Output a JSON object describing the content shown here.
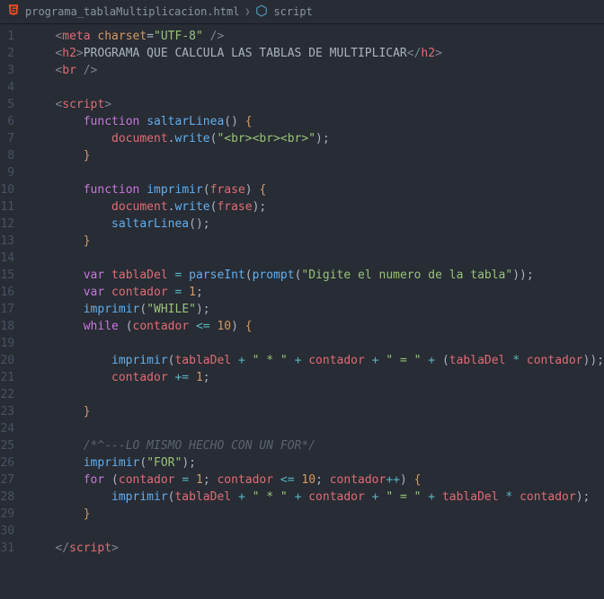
{
  "breadcrumb": {
    "file": "programa_tablaMultiplicacion.html",
    "symbol": "script"
  },
  "lines": [
    {
      "n": "1",
      "seg": [
        [
          "t-gray",
          "    <"
        ],
        [
          "t-red",
          "meta"
        ],
        [
          "t-white",
          " "
        ],
        [
          "t-orange",
          "charset"
        ],
        [
          "t-white",
          "="
        ],
        [
          "t-green",
          "\"UTF-8\""
        ],
        [
          "t-white",
          " "
        ],
        [
          "t-gray",
          "/>"
        ]
      ]
    },
    {
      "n": "2",
      "seg": [
        [
          "t-gray",
          "    <"
        ],
        [
          "t-red",
          "h2"
        ],
        [
          "t-gray",
          ">"
        ],
        [
          "t-white",
          "PROGRAMA QUE CALCULA LAS TABLAS DE MULTIPLICAR"
        ],
        [
          "t-gray",
          "</"
        ],
        [
          "t-red",
          "h2"
        ],
        [
          "t-gray",
          ">"
        ]
      ]
    },
    {
      "n": "3",
      "seg": [
        [
          "t-gray",
          "    <"
        ],
        [
          "t-red",
          "br"
        ],
        [
          "t-white",
          " "
        ],
        [
          "t-gray",
          "/>"
        ]
      ]
    },
    {
      "n": "4",
      "seg": [
        [
          "",
          ""
        ]
      ]
    },
    {
      "n": "5",
      "seg": [
        [
          "t-gray",
          "    <"
        ],
        [
          "t-red",
          "script"
        ],
        [
          "t-gray",
          ">"
        ]
      ]
    },
    {
      "n": "6",
      "seg": [
        [
          "t-white",
          "        "
        ],
        [
          "t-purple",
          "function"
        ],
        [
          "t-white",
          " "
        ],
        [
          "t-blue",
          "saltarLinea"
        ],
        [
          "t-white",
          "() "
        ],
        [
          "t-orange",
          "{"
        ]
      ]
    },
    {
      "n": "7",
      "seg": [
        [
          "t-white",
          "            "
        ],
        [
          "t-red",
          "document"
        ],
        [
          "t-white",
          "."
        ],
        [
          "t-blue",
          "write"
        ],
        [
          "t-white",
          "("
        ],
        [
          "t-green",
          "\"<br><br><br>\""
        ],
        [
          "t-white",
          ");"
        ]
      ]
    },
    {
      "n": "8",
      "seg": [
        [
          "t-white",
          "        "
        ],
        [
          "t-orange",
          "}"
        ]
      ]
    },
    {
      "n": "9",
      "seg": [
        [
          "",
          ""
        ]
      ]
    },
    {
      "n": "10",
      "seg": [
        [
          "t-white",
          "        "
        ],
        [
          "t-purple",
          "function"
        ],
        [
          "t-white",
          " "
        ],
        [
          "t-blue",
          "imprimir"
        ],
        [
          "t-white",
          "("
        ],
        [
          "t-red",
          "frase"
        ],
        [
          "t-white",
          ") "
        ],
        [
          "t-orange",
          "{"
        ]
      ]
    },
    {
      "n": "11",
      "seg": [
        [
          "t-white",
          "            "
        ],
        [
          "t-red",
          "document"
        ],
        [
          "t-white",
          "."
        ],
        [
          "t-blue",
          "write"
        ],
        [
          "t-white",
          "("
        ],
        [
          "t-red",
          "frase"
        ],
        [
          "t-white",
          ");"
        ]
      ]
    },
    {
      "n": "12",
      "seg": [
        [
          "t-white",
          "            "
        ],
        [
          "t-blue",
          "saltarLinea"
        ],
        [
          "t-white",
          "();"
        ]
      ]
    },
    {
      "n": "13",
      "seg": [
        [
          "t-white",
          "        "
        ],
        [
          "t-orange",
          "}"
        ]
      ]
    },
    {
      "n": "14",
      "seg": [
        [
          "",
          ""
        ]
      ]
    },
    {
      "n": "15",
      "seg": [
        [
          "t-white",
          "        "
        ],
        [
          "t-purple",
          "var"
        ],
        [
          "t-white",
          " "
        ],
        [
          "t-red",
          "tablaDel"
        ],
        [
          "t-white",
          " "
        ],
        [
          "t-teal",
          "="
        ],
        [
          "t-white",
          " "
        ],
        [
          "t-blue",
          "parseInt"
        ],
        [
          "t-white",
          "("
        ],
        [
          "t-blue",
          "prompt"
        ],
        [
          "t-white",
          "("
        ],
        [
          "t-green",
          "\"Digite el numero de la tabla\""
        ],
        [
          "t-white",
          "));"
        ]
      ]
    },
    {
      "n": "16",
      "seg": [
        [
          "t-white",
          "        "
        ],
        [
          "t-purple",
          "var"
        ],
        [
          "t-white",
          " "
        ],
        [
          "t-red",
          "contador"
        ],
        [
          "t-white",
          " "
        ],
        [
          "t-teal",
          "="
        ],
        [
          "t-white",
          " "
        ],
        [
          "t-orange",
          "1"
        ],
        [
          "t-white",
          ";"
        ]
      ]
    },
    {
      "n": "17",
      "seg": [
        [
          "t-white",
          "        "
        ],
        [
          "t-blue",
          "imprimir"
        ],
        [
          "t-white",
          "("
        ],
        [
          "t-green",
          "\"WHILE\""
        ],
        [
          "t-white",
          ");"
        ]
      ]
    },
    {
      "n": "18",
      "seg": [
        [
          "t-white",
          "        "
        ],
        [
          "t-purple",
          "while"
        ],
        [
          "t-white",
          " ("
        ],
        [
          "t-red",
          "contador"
        ],
        [
          "t-white",
          " "
        ],
        [
          "t-teal",
          "<="
        ],
        [
          "t-white",
          " "
        ],
        [
          "t-orange",
          "10"
        ],
        [
          "t-white",
          ") "
        ],
        [
          "t-orange",
          "{"
        ]
      ]
    },
    {
      "n": "19",
      "seg": [
        [
          "",
          ""
        ]
      ]
    },
    {
      "n": "20",
      "seg": [
        [
          "t-white",
          "            "
        ],
        [
          "t-blue",
          "imprimir"
        ],
        [
          "t-white",
          "("
        ],
        [
          "t-red",
          "tablaDel"
        ],
        [
          "t-white",
          " "
        ],
        [
          "t-teal",
          "+"
        ],
        [
          "t-white",
          " "
        ],
        [
          "t-green",
          "\" * \""
        ],
        [
          "t-white",
          " "
        ],
        [
          "t-teal",
          "+"
        ],
        [
          "t-white",
          " "
        ],
        [
          "t-red",
          "contador"
        ],
        [
          "t-white",
          " "
        ],
        [
          "t-teal",
          "+"
        ],
        [
          "t-white",
          " "
        ],
        [
          "t-green",
          "\" = \""
        ],
        [
          "t-white",
          " "
        ],
        [
          "t-teal",
          "+"
        ],
        [
          "t-white",
          " ("
        ],
        [
          "t-red",
          "tablaDel"
        ],
        [
          "t-white",
          " "
        ],
        [
          "t-teal",
          "*"
        ],
        [
          "t-white",
          " "
        ],
        [
          "t-red",
          "contador"
        ],
        [
          "t-white",
          "));"
        ]
      ]
    },
    {
      "n": "21",
      "seg": [
        [
          "t-white",
          "            "
        ],
        [
          "t-red",
          "contador"
        ],
        [
          "t-white",
          " "
        ],
        [
          "t-teal",
          "+="
        ],
        [
          "t-white",
          " "
        ],
        [
          "t-orange",
          "1"
        ],
        [
          "t-white",
          ";"
        ]
      ]
    },
    {
      "n": "22",
      "seg": [
        [
          "",
          ""
        ]
      ]
    },
    {
      "n": "23",
      "seg": [
        [
          "t-white",
          "        "
        ],
        [
          "t-orange",
          "}"
        ]
      ]
    },
    {
      "n": "24",
      "seg": [
        [
          "",
          ""
        ]
      ]
    },
    {
      "n": "25",
      "seg": [
        [
          "t-white",
          "        "
        ],
        [
          "t-comment",
          "/*^---LO MISMO HECHO CON UN FOR*/"
        ]
      ]
    },
    {
      "n": "26",
      "seg": [
        [
          "t-white",
          "        "
        ],
        [
          "t-blue",
          "imprimir"
        ],
        [
          "t-white",
          "("
        ],
        [
          "t-green",
          "\"FOR\""
        ],
        [
          "t-white",
          ");"
        ]
      ]
    },
    {
      "n": "27",
      "seg": [
        [
          "t-white",
          "        "
        ],
        [
          "t-purple",
          "for"
        ],
        [
          "t-white",
          " ("
        ],
        [
          "t-red",
          "contador"
        ],
        [
          "t-white",
          " "
        ],
        [
          "t-teal",
          "="
        ],
        [
          "t-white",
          " "
        ],
        [
          "t-orange",
          "1"
        ],
        [
          "t-white",
          "; "
        ],
        [
          "t-red",
          "contador"
        ],
        [
          "t-white",
          " "
        ],
        [
          "t-teal",
          "<="
        ],
        [
          "t-white",
          " "
        ],
        [
          "t-orange",
          "10"
        ],
        [
          "t-white",
          "; "
        ],
        [
          "t-red",
          "contador"
        ],
        [
          "t-teal",
          "++"
        ],
        [
          "t-white",
          ") "
        ],
        [
          "t-orange",
          "{"
        ]
      ]
    },
    {
      "n": "28",
      "seg": [
        [
          "t-white",
          "            "
        ],
        [
          "t-blue",
          "imprimir"
        ],
        [
          "t-white",
          "("
        ],
        [
          "t-red",
          "tablaDel"
        ],
        [
          "t-white",
          " "
        ],
        [
          "t-teal",
          "+"
        ],
        [
          "t-white",
          " "
        ],
        [
          "t-green",
          "\" * \""
        ],
        [
          "t-white",
          " "
        ],
        [
          "t-teal",
          "+"
        ],
        [
          "t-white",
          " "
        ],
        [
          "t-red",
          "contador"
        ],
        [
          "t-white",
          " "
        ],
        [
          "t-teal",
          "+"
        ],
        [
          "t-white",
          " "
        ],
        [
          "t-green",
          "\" = \""
        ],
        [
          "t-white",
          " "
        ],
        [
          "t-teal",
          "+"
        ],
        [
          "t-white",
          " "
        ],
        [
          "t-red",
          "tablaDel"
        ],
        [
          "t-white",
          " "
        ],
        [
          "t-teal",
          "*"
        ],
        [
          "t-white",
          " "
        ],
        [
          "t-red",
          "contador"
        ],
        [
          "t-white",
          ");"
        ]
      ]
    },
    {
      "n": "29",
      "seg": [
        [
          "t-white",
          "        "
        ],
        [
          "t-orange",
          "}"
        ]
      ]
    },
    {
      "n": "30",
      "seg": [
        [
          "",
          ""
        ]
      ]
    },
    {
      "n": "31",
      "seg": [
        [
          "t-gray",
          "    </"
        ],
        [
          "t-red",
          "script"
        ],
        [
          "t-gray",
          ">"
        ]
      ]
    }
  ]
}
